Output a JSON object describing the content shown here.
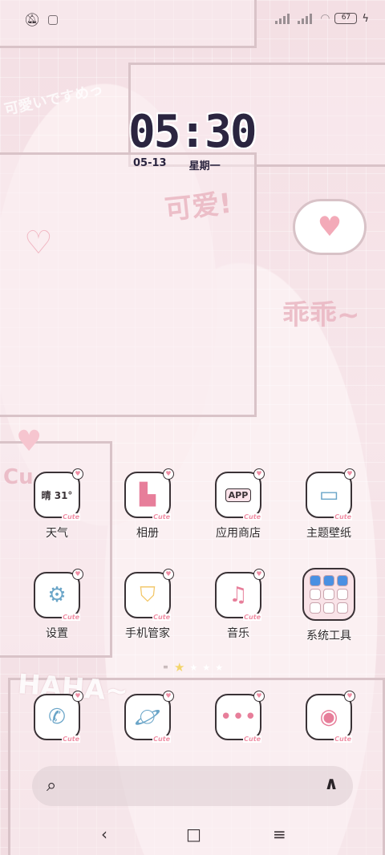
{
  "status_bar": {
    "battery": "67",
    "icons": [
      "mute-bell-icon",
      "app-notification-icon",
      "signal-1-icon",
      "signal-2-icon",
      "wifi-icon",
      "battery-icon",
      "charging-bolt-icon"
    ]
  },
  "clock": {
    "time": "05:30",
    "date": "05-13",
    "weekday": "星期一"
  },
  "wallpaper_text": {
    "cute": "可爱!",
    "obedient": "乖乖~",
    "haha": "HAHA~",
    "cu": "Cu",
    "jp": "可愛いですめっ"
  },
  "apps_row1": [
    {
      "label": "天气",
      "icon": "weather-icon",
      "badge": "晴 31°"
    },
    {
      "label": "相册",
      "icon": "gallery-icon"
    },
    {
      "label": "应用商店",
      "icon": "app-store-icon",
      "badge": "APP"
    },
    {
      "label": "主题壁纸",
      "icon": "theme-roller-icon"
    }
  ],
  "apps_row2": [
    {
      "label": "设置",
      "icon": "gear-icon"
    },
    {
      "label": "手机管家",
      "icon": "shield-icon"
    },
    {
      "label": "音乐",
      "icon": "music-icon"
    },
    {
      "label": "系统工具",
      "icon": "folder-icon"
    }
  ],
  "dock": [
    {
      "icon": "phone-icon"
    },
    {
      "icon": "browser-planet-icon"
    },
    {
      "icon": "messages-icon"
    },
    {
      "icon": "camera-icon"
    }
  ],
  "cute_tag": "Cute",
  "search": {
    "icons": [
      "search-icon",
      "assistant-icon"
    ]
  },
  "navbar": {
    "back": "‹",
    "home": "□",
    "recents": "≡"
  }
}
